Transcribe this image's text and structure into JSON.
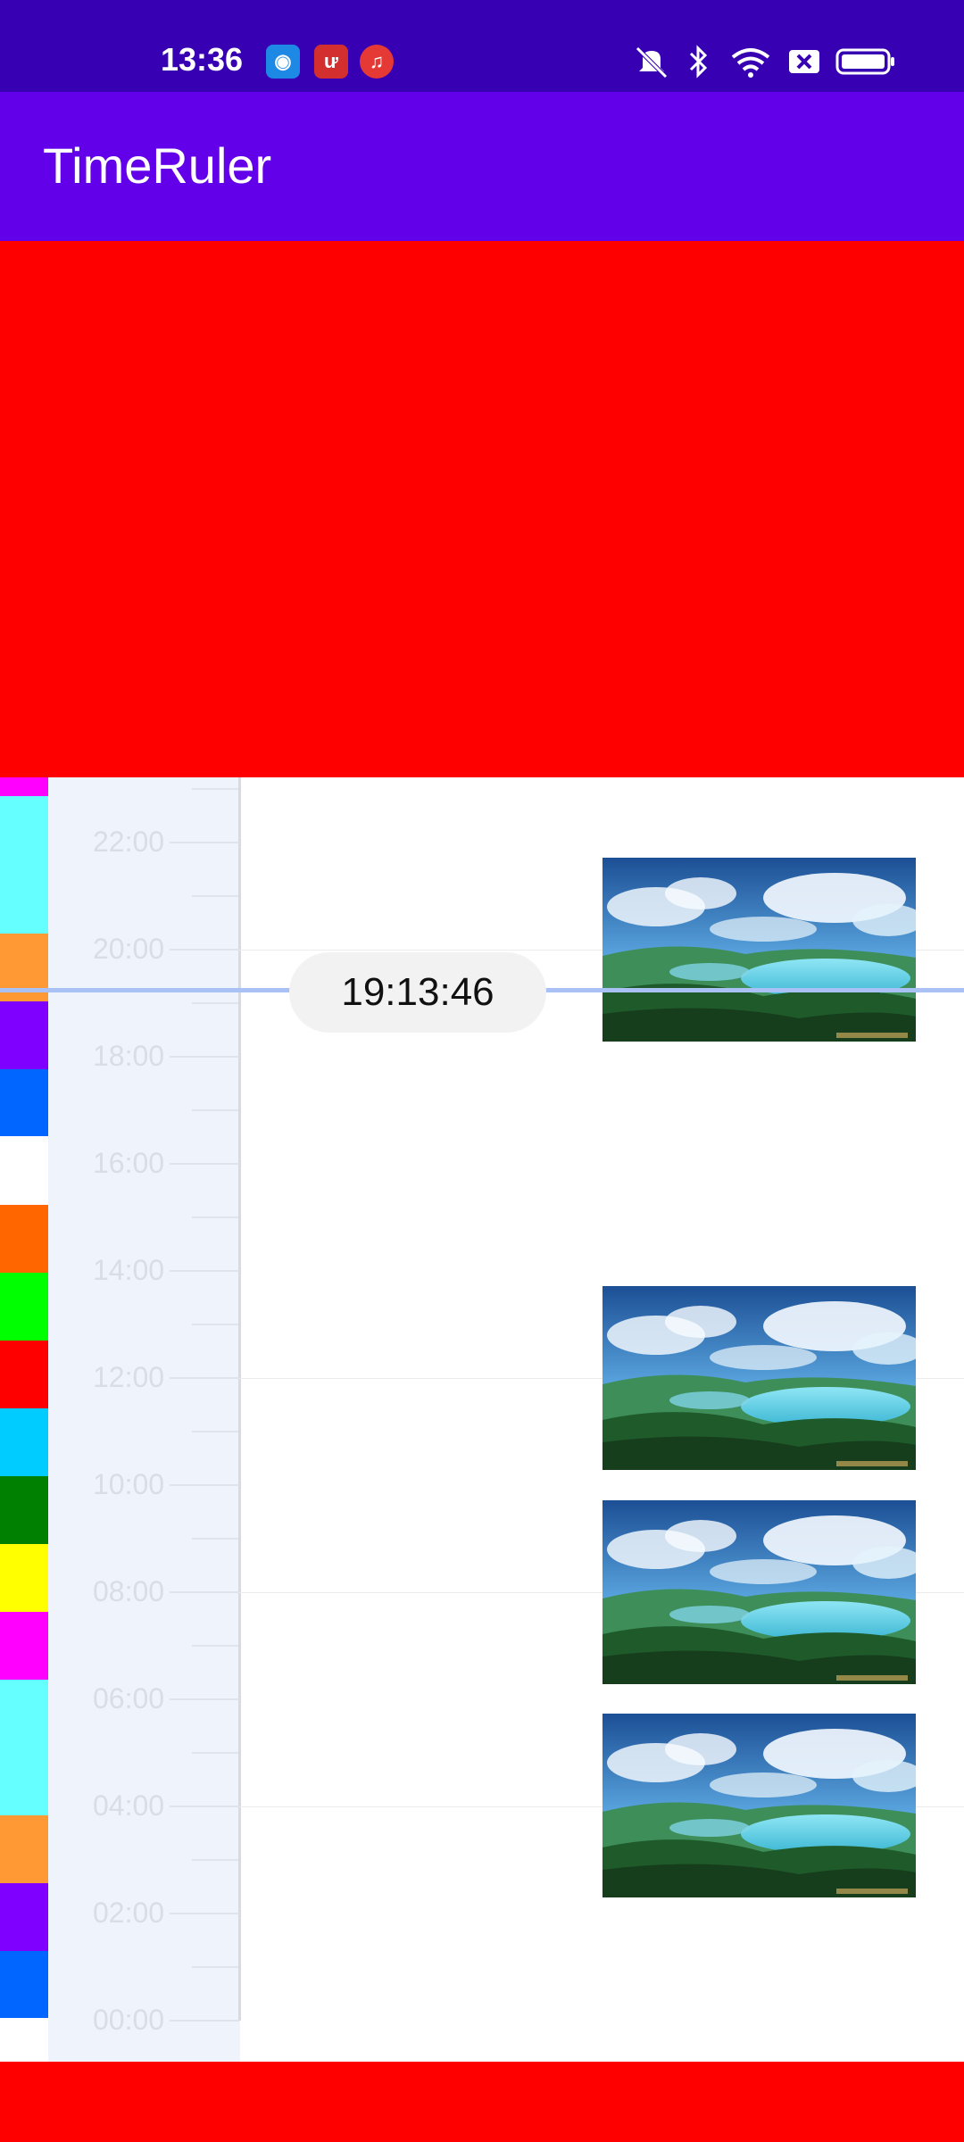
{
  "status_bar": {
    "time": "13:36",
    "app_icons": [
      "browser-app-icon",
      "clipboard-app-icon",
      "music-app-icon"
    ],
    "right_icons": [
      "mute-icon",
      "bluetooth-icon",
      "wifi-icon",
      "no-sim-icon",
      "battery-icon"
    ]
  },
  "app_bar": {
    "title": "TimeRuler"
  },
  "ruler": {
    "hour_labels": [
      "22:00",
      "20:00",
      "18:00",
      "16:00",
      "14:00",
      "12:00",
      "10:00",
      "08:00",
      "06:00",
      "04:00",
      "02:00",
      "00:00"
    ],
    "cursor_time": "19:13:46"
  },
  "color_segments": [
    "#ff00ff",
    "#66ffff",
    "#ff9933",
    "#7f00ff",
    "#0066ff",
    "#ff6600",
    "#00ff00",
    "#ff0000",
    "#00ccff",
    "#008000",
    "#ffff00",
    "#ff00ff",
    "#66ffff",
    "#ff9933",
    "#7f00ff",
    "#0066ff"
  ],
  "colors": {
    "status_bar": "#3700b3",
    "app_bar": "#6200ea",
    "red_panel": "#ff0000",
    "ruler_bg": "#eef3fc",
    "cursor_line": "#a9c1f5"
  },
  "thumbnails": [
    "landscape-thumbnail",
    "landscape-thumbnail",
    "landscape-thumbnail",
    "landscape-thumbnail"
  ]
}
